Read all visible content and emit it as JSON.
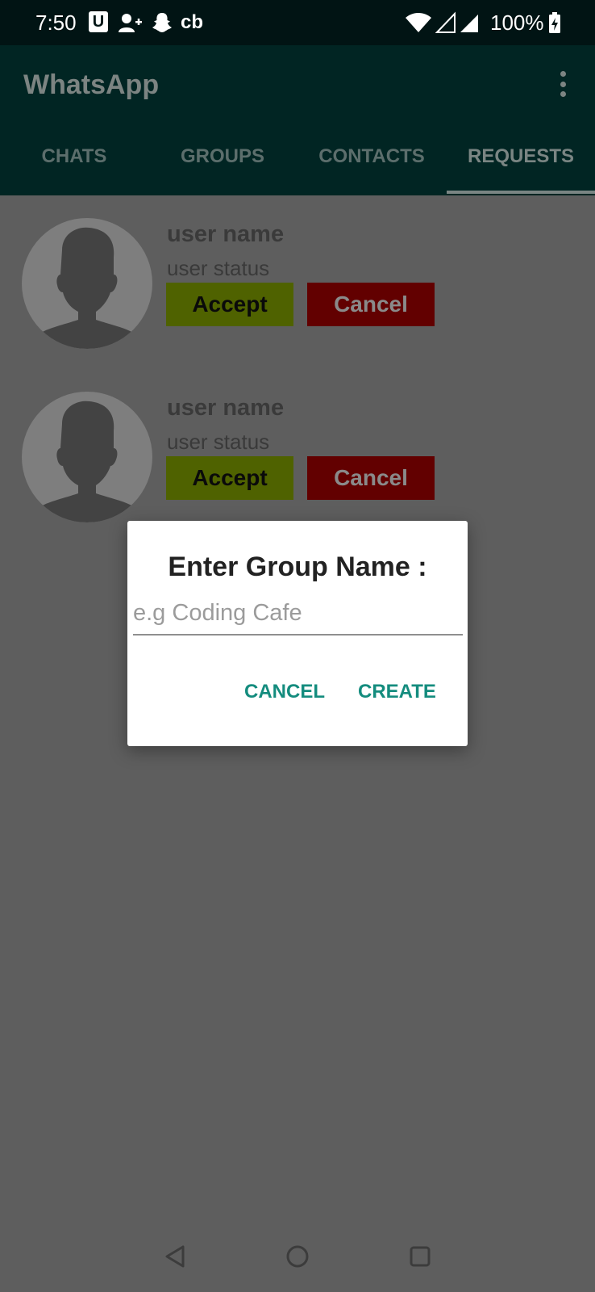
{
  "status_bar": {
    "time": "7:50",
    "u_badge": "U",
    "cb_label": "cb",
    "battery": "100%",
    "icons": [
      "u-icon",
      "person-add-icon",
      "snapchat-icon",
      "cb-icon",
      "wifi-icon",
      "signal-empty-icon",
      "signal-icon",
      "battery-charging-icon"
    ]
  },
  "app_bar": {
    "title": "WhatsApp",
    "menu_icon": "more-vert-icon"
  },
  "tabs": [
    {
      "label": "CHATS"
    },
    {
      "label": "GROUPS"
    },
    {
      "label": "CONTACTS"
    },
    {
      "label": "REQUESTS",
      "active": true
    }
  ],
  "requests": [
    {
      "name": "user name",
      "status": "user status",
      "accept_label": "Accept",
      "cancel_label": "Cancel"
    },
    {
      "name": "user name",
      "status": "user status",
      "accept_label": "Accept",
      "cancel_label": "Cancel"
    }
  ],
  "dialog": {
    "title": "Enter Group Name :",
    "input_value": "",
    "input_placeholder": "e.g Coding Cafe",
    "cancel_label": "CANCEL",
    "create_label": "CREATE"
  },
  "nav_bar": {
    "icons": [
      "back-icon",
      "home-icon",
      "recents-icon"
    ]
  },
  "colors": {
    "status_bar_bg": "#011414",
    "app_bar_bg": "#012523",
    "scrim_bg": "#5e5e5e",
    "accept_bg": "#4f6200",
    "cancel_bg": "#620000",
    "dialog_button": "#148c7e"
  }
}
